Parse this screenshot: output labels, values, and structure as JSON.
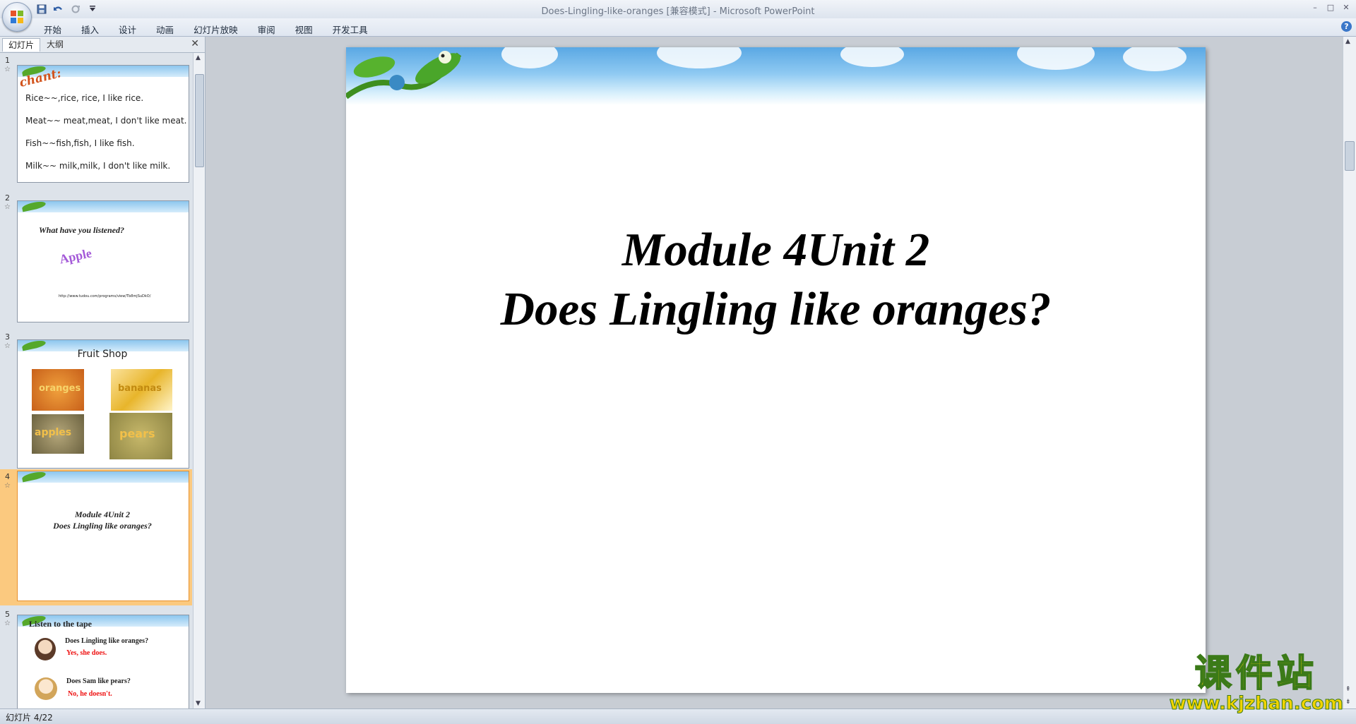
{
  "window": {
    "title": "Does-Lingling-like-oranges [兼容模式] - Microsoft PowerPoint",
    "min": "–",
    "max": "□",
    "close": "✕"
  },
  "qat": {
    "icons": [
      "save-icon",
      "undo-icon",
      "redo-icon",
      "customize-icon"
    ]
  },
  "ribbon": {
    "tabs": [
      "开始",
      "插入",
      "设计",
      "动画",
      "幻灯片放映",
      "审阅",
      "视图",
      "开发工具"
    ],
    "help": "?"
  },
  "leftpane": {
    "tabs": [
      "幻灯片",
      "大纲"
    ],
    "close": "✕",
    "slides": [
      {
        "num": "1",
        "chant": "chant:",
        "lines": [
          "Rice~~,rice, rice, I like rice.",
          "Meat~~ meat,meat, I  don't like meat.",
          "Fish~~fish,fish, I like fish.",
          "Milk~~ milk,milk, I don't like milk."
        ]
      },
      {
        "num": "2",
        "heading": "What have you listened?",
        "word": "Apple",
        "url": "http://www.tudou.com/programs/view/Tb8mjSuDkO/"
      },
      {
        "num": "3",
        "heading": "Fruit Shop",
        "labels": [
          "oranges",
          "bananas",
          "apples",
          "pears"
        ]
      },
      {
        "num": "4",
        "line1": "Module 4Unit 2",
        "line2": "Does Lingling like oranges?"
      },
      {
        "num": "5",
        "heading": "Listen to the tape",
        "q1": "Does Lingling like oranges?",
        "a1": "Yes, she does.",
        "q2": "Does Sam like pears?",
        "a2": "No, he doesn't."
      }
    ]
  },
  "slide": {
    "line1": "Module 4Unit 2",
    "line2": "Does Lingling like oranges?"
  },
  "status": {
    "text": "幻灯片 4/22"
  },
  "watermark": {
    "cn": "课件站",
    "url": "www.kjzhan.com"
  }
}
